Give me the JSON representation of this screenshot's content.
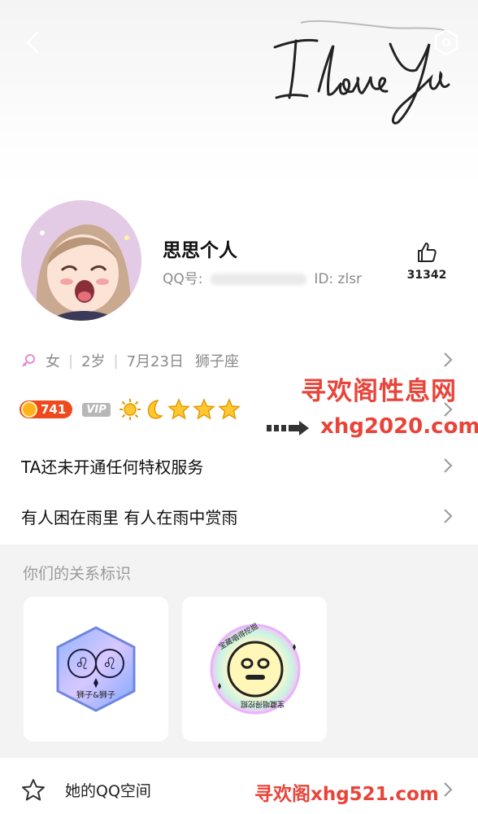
{
  "cover": {
    "script_text": "I love You"
  },
  "profile": {
    "name": "思思个人",
    "qq_label": "QQ号:",
    "id_label": "ID: zlsr",
    "like_count": "31342"
  },
  "info": {
    "gender": "女",
    "age": "2岁",
    "birthday": "7月23日",
    "zodiac": "狮子座"
  },
  "badges": {
    "level": "741",
    "vip": "VIP"
  },
  "rows": {
    "privilege": "TA还未开通任何特权服务",
    "signature": "有人困在雨里 有人在雨中赏雨"
  },
  "relation": {
    "title": "你们的关系标识",
    "card1_label": "狮子&狮子",
    "card2_ring_top": "宝藏唱得挖掘",
    "card2_ring_bottom": "宝藏唱得挖掘"
  },
  "bottom": {
    "label": "她的QQ空间"
  },
  "watermarks": {
    "line1": "寻欢阁性息网",
    "line2": "xhg2020.com",
    "line3": "寻欢阁xhg521.com"
  },
  "colors": {
    "accent": "#e8443a",
    "level_bg": "#ee4a1e",
    "panel_bg": "#f3f3f3"
  }
}
